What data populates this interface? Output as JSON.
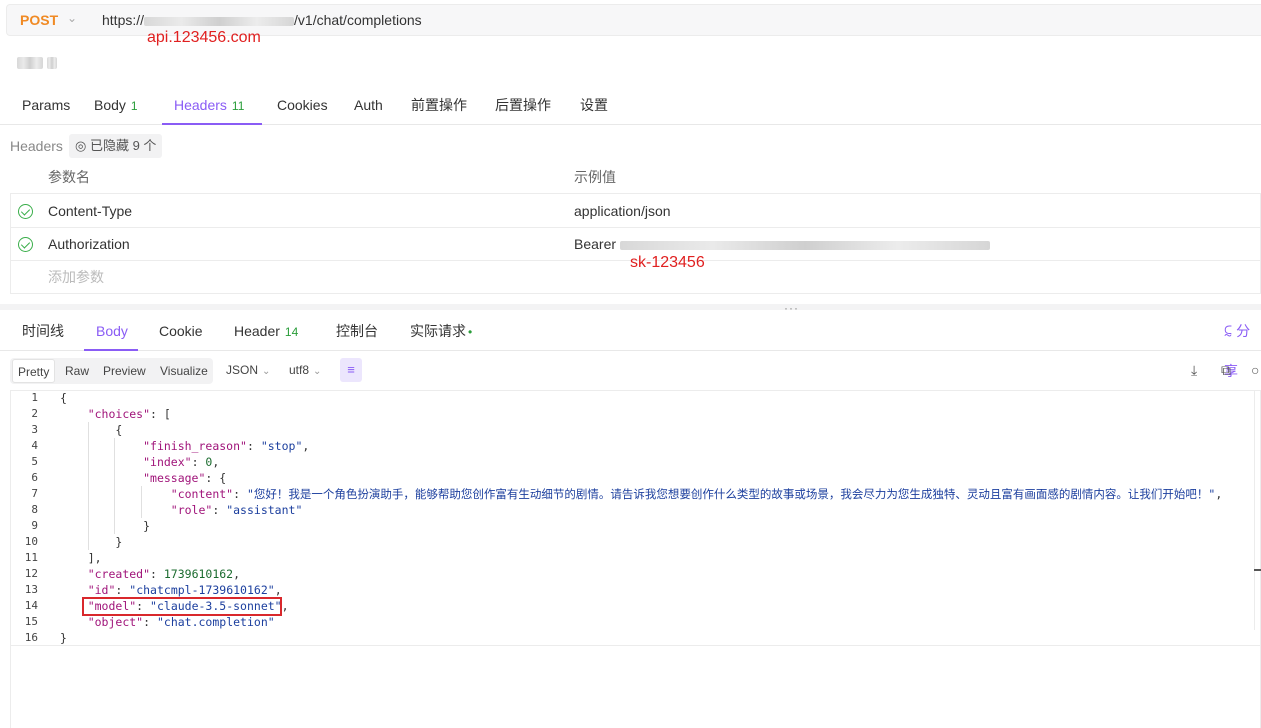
{
  "request": {
    "method": "POST",
    "url_prefix": "https://",
    "url_suffix": "/v1/chat/completions",
    "url_annotation": "api.123456.com"
  },
  "request_tabs": [
    {
      "label": "Params",
      "badge": ""
    },
    {
      "label": "Body",
      "badge": "1"
    },
    {
      "label": "Headers",
      "badge": "11"
    },
    {
      "label": "Cookies",
      "badge": ""
    },
    {
      "label": "Auth",
      "badge": ""
    },
    {
      "label": "前置操作",
      "badge": ""
    },
    {
      "label": "后置操作",
      "badge": ""
    },
    {
      "label": "设置",
      "badge": ""
    }
  ],
  "active_request_tab": "Headers",
  "headers": {
    "label": "Headers",
    "hidden_chip": "已隐藏 9 个",
    "col_name": "参数名",
    "col_value": "示例值",
    "rows": [
      {
        "name": "Content-Type",
        "value": "application/json"
      },
      {
        "name": "Authorization",
        "value": "Bearer"
      }
    ],
    "key_annotation": "sk-123456",
    "add_placeholder": "添加参数"
  },
  "response_tabs": [
    {
      "label": "时间线",
      "badge": ""
    },
    {
      "label": "Body",
      "badge": ""
    },
    {
      "label": "Cookie",
      "badge": ""
    },
    {
      "label": "Header",
      "badge": "14"
    },
    {
      "label": "控制台",
      "badge": ""
    },
    {
      "label": "实际请求",
      "badge": "•"
    }
  ],
  "active_response_tab": "Body",
  "share_label": "分享",
  "view_modes": [
    "Pretty",
    "Raw",
    "Preview",
    "Visualize"
  ],
  "active_view_mode": "Pretty",
  "format_select": "JSON",
  "encoding_select": "utf8",
  "icons": {
    "wrap": "wrap-lines-icon",
    "download": "download-icon",
    "copy": "copy-icon",
    "search": "search-icon",
    "share": "share-icon"
  },
  "colors": {
    "accent": "#8a5cf5",
    "method": "#f08a24",
    "badge": "#2a9d3a",
    "annotation": "#e02020"
  },
  "response_body": {
    "line_numbers": [
      "1",
      "2",
      "3",
      "4",
      "5",
      "6",
      "7",
      "8",
      "9",
      "10",
      "11",
      "12",
      "13",
      "14",
      "15",
      "16"
    ],
    "finish_reason": "stop",
    "index": "0",
    "content": "您好！我是一个角色扮演助手，能够帮助您创作富有生动细节的剧情。请告诉我您想要创作什么类型的故事或场景，我会尽力为您生成独特、灵动且富有画面感的剧情内容。让我们开始吧！",
    "role": "assistant",
    "created": "1739610162",
    "id": "chatcmpl-1739610162",
    "model": "claude-3.5-sonnet",
    "object": "chat.completion"
  }
}
